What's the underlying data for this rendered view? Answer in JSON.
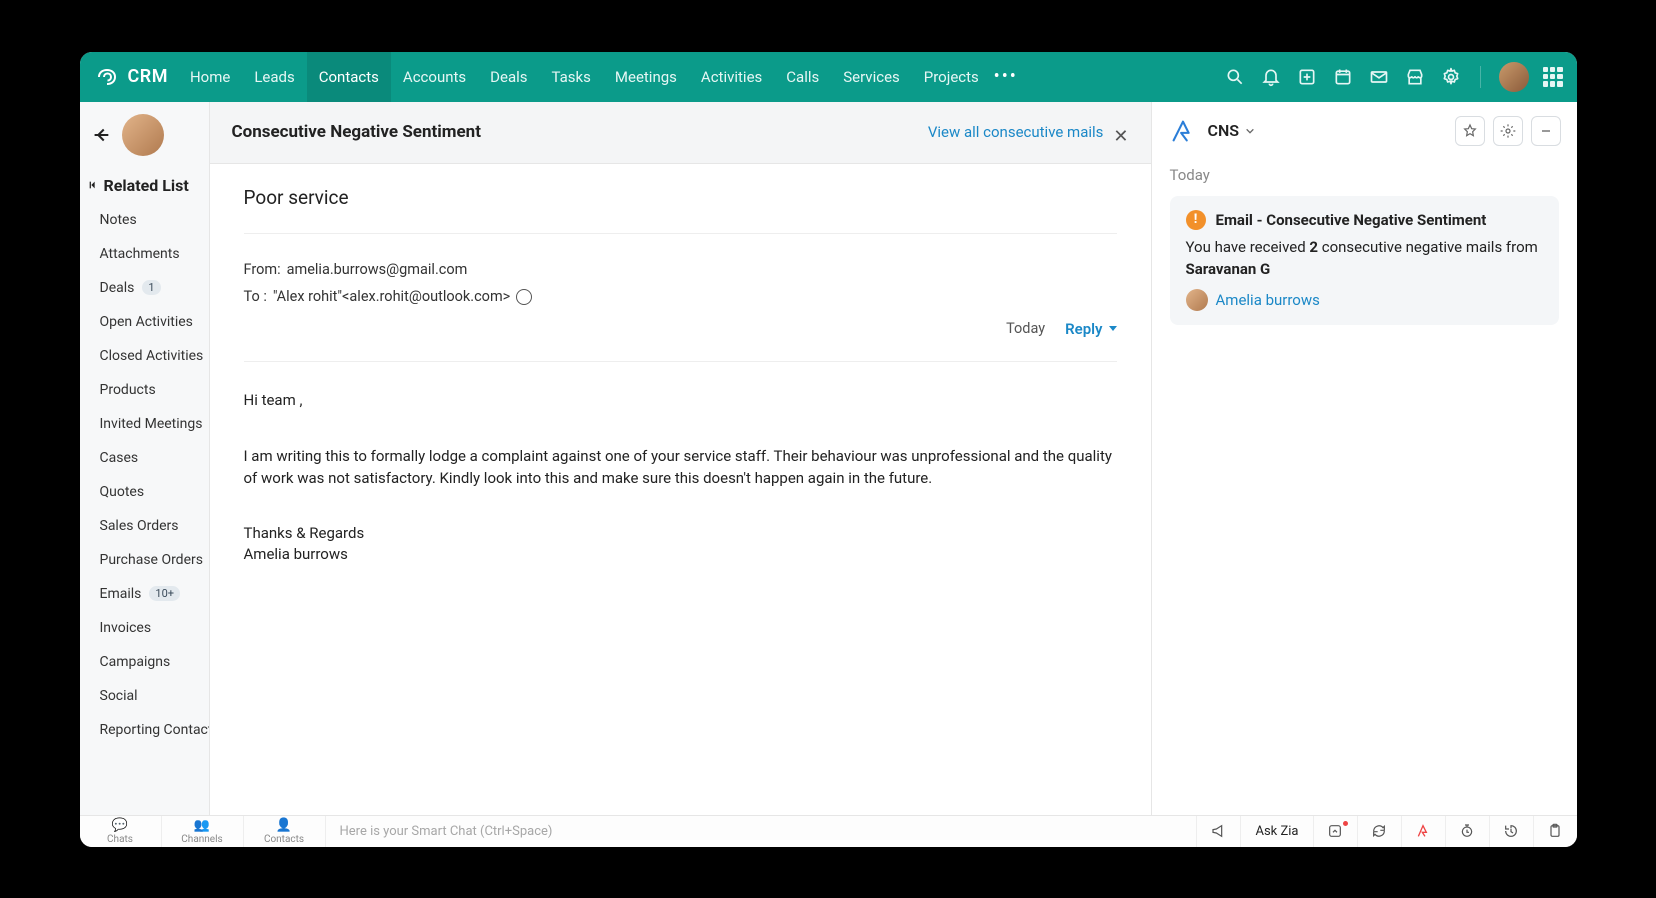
{
  "topnav": {
    "brand": "CRM",
    "items": [
      "Home",
      "Leads",
      "Contacts",
      "Accounts",
      "Deals",
      "Tasks",
      "Meetings",
      "Activities",
      "Calls",
      "Services",
      "Projects"
    ],
    "active_index": 2
  },
  "sidebar": {
    "heading": "Related List",
    "items": [
      {
        "label": "Notes"
      },
      {
        "label": "Attachments"
      },
      {
        "label": "Deals",
        "badge": "1"
      },
      {
        "label": "Open Activities"
      },
      {
        "label": "Closed Activities"
      },
      {
        "label": "Products"
      },
      {
        "label": "Invited Meetings"
      },
      {
        "label": "Cases"
      },
      {
        "label": "Quotes"
      },
      {
        "label": "Sales Orders"
      },
      {
        "label": "Purchase Orders"
      },
      {
        "label": "Emails",
        "badge": "10+"
      },
      {
        "label": "Invoices"
      },
      {
        "label": "Campaigns"
      },
      {
        "label": "Social"
      },
      {
        "label": "Reporting Contacts"
      }
    ]
  },
  "main": {
    "header_title": "Consecutive Negative Sentiment",
    "header_link": "View all consecutive mails",
    "subject": "Poor service",
    "from_label": "From: ",
    "from_value": "amelia.burrows@gmail.com",
    "to_label": "To : ",
    "to_value": "\"Alex rohit\"<alex.rohit@outlook.com>",
    "date": "Today",
    "reply": "Reply",
    "body_greeting": "Hi team ,",
    "body_para": "I am writing this to formally lodge a complaint against one of your service staff. Their behaviour was unprofessional and the quality of work was not satisfactory. Kindly look into this and make sure this doesn't happen again in the future.",
    "sig1": "Thanks & Regards",
    "sig2": "Amelia burrows"
  },
  "right": {
    "title": "CNS",
    "day": "Today",
    "card_title": "Email - Consecutive Negative Sentiment",
    "card_text_pre": "You have received ",
    "card_count": "2",
    "card_text_post": " consecutive negative mails from ",
    "card_sender": "Saravanan G",
    "card_link": "Amelia burrows"
  },
  "bottombar": {
    "tabs": [
      "Chats",
      "Channels",
      "Contacts"
    ],
    "placeholder": "Here is your Smart Chat (Ctrl+Space)",
    "askzia": "Ask Zia"
  }
}
